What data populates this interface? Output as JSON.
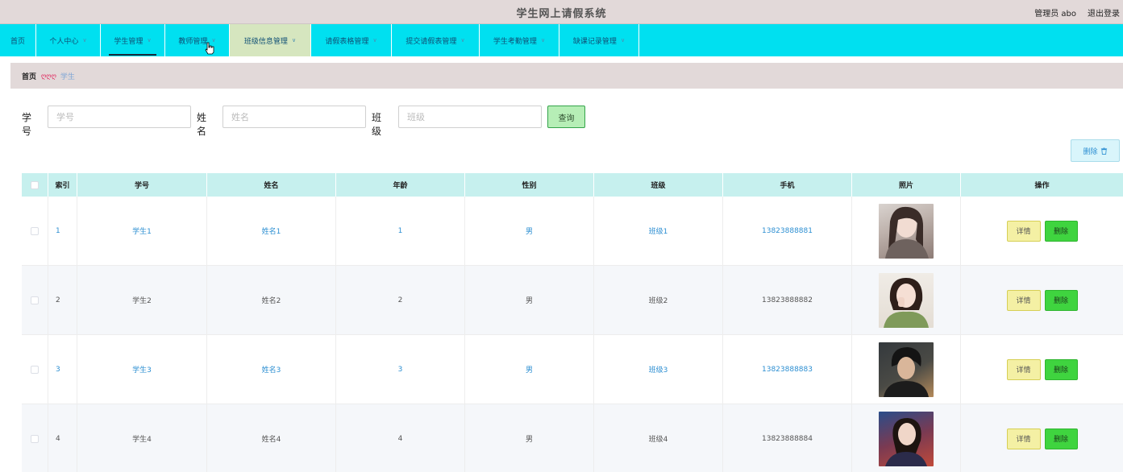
{
  "header": {
    "title": "学生网上请假系统",
    "admin": "管理员 abo",
    "logout": "退出登录"
  },
  "nav": {
    "items": [
      {
        "label": "首页"
      },
      {
        "label": "个人中心"
      },
      {
        "label": "学生管理"
      },
      {
        "label": "教师管理"
      },
      {
        "label": "班级信息管理"
      },
      {
        "label": "请假表格管理"
      },
      {
        "label": "提交请假表管理"
      },
      {
        "label": "学生考勤管理"
      },
      {
        "label": "缺课记录管理"
      }
    ]
  },
  "breadcrumb": {
    "home": "首页",
    "separator": "ღღღ",
    "current": "学生"
  },
  "search": {
    "fields": [
      {
        "label": "学号",
        "placeholder": "学号"
      },
      {
        "label": "姓名",
        "placeholder": "姓名"
      },
      {
        "label": "班级",
        "placeholder": "班级"
      }
    ],
    "query_button": "查询"
  },
  "toolbar": {
    "delete_label": "删除",
    "delete_icon": "trash-icon"
  },
  "table": {
    "columns": [
      "",
      "索引",
      "学号",
      "姓名",
      "年龄",
      "性别",
      "班级",
      "手机",
      "照片",
      "操作"
    ],
    "rows": [
      {
        "index": "1",
        "student_no": "学生1",
        "name": "姓名1",
        "age": "1",
        "gender": "男",
        "class": "班级1",
        "phone": "13823888881"
      },
      {
        "index": "2",
        "student_no": "学生2",
        "name": "姓名2",
        "age": "2",
        "gender": "男",
        "class": "班级2",
        "phone": "13823888882"
      },
      {
        "index": "3",
        "student_no": "学生3",
        "name": "姓名3",
        "age": "3",
        "gender": "男",
        "class": "班级3",
        "phone": "13823888883"
      },
      {
        "index": "4",
        "student_no": "学生4",
        "name": "姓名4",
        "age": "4",
        "gender": "男",
        "class": "班级4",
        "phone": "13823888884"
      }
    ],
    "detail_label": "详情",
    "delete_label": "删除"
  },
  "colors": {
    "nav_bg": "#00e0f0",
    "header_bg": "#e2d9d9",
    "table_header_bg": "#c6f0ee",
    "link_blue": "#2d8fd2",
    "detail_btn": "#f4f0a4",
    "delete_btn": "#3fd43f"
  }
}
